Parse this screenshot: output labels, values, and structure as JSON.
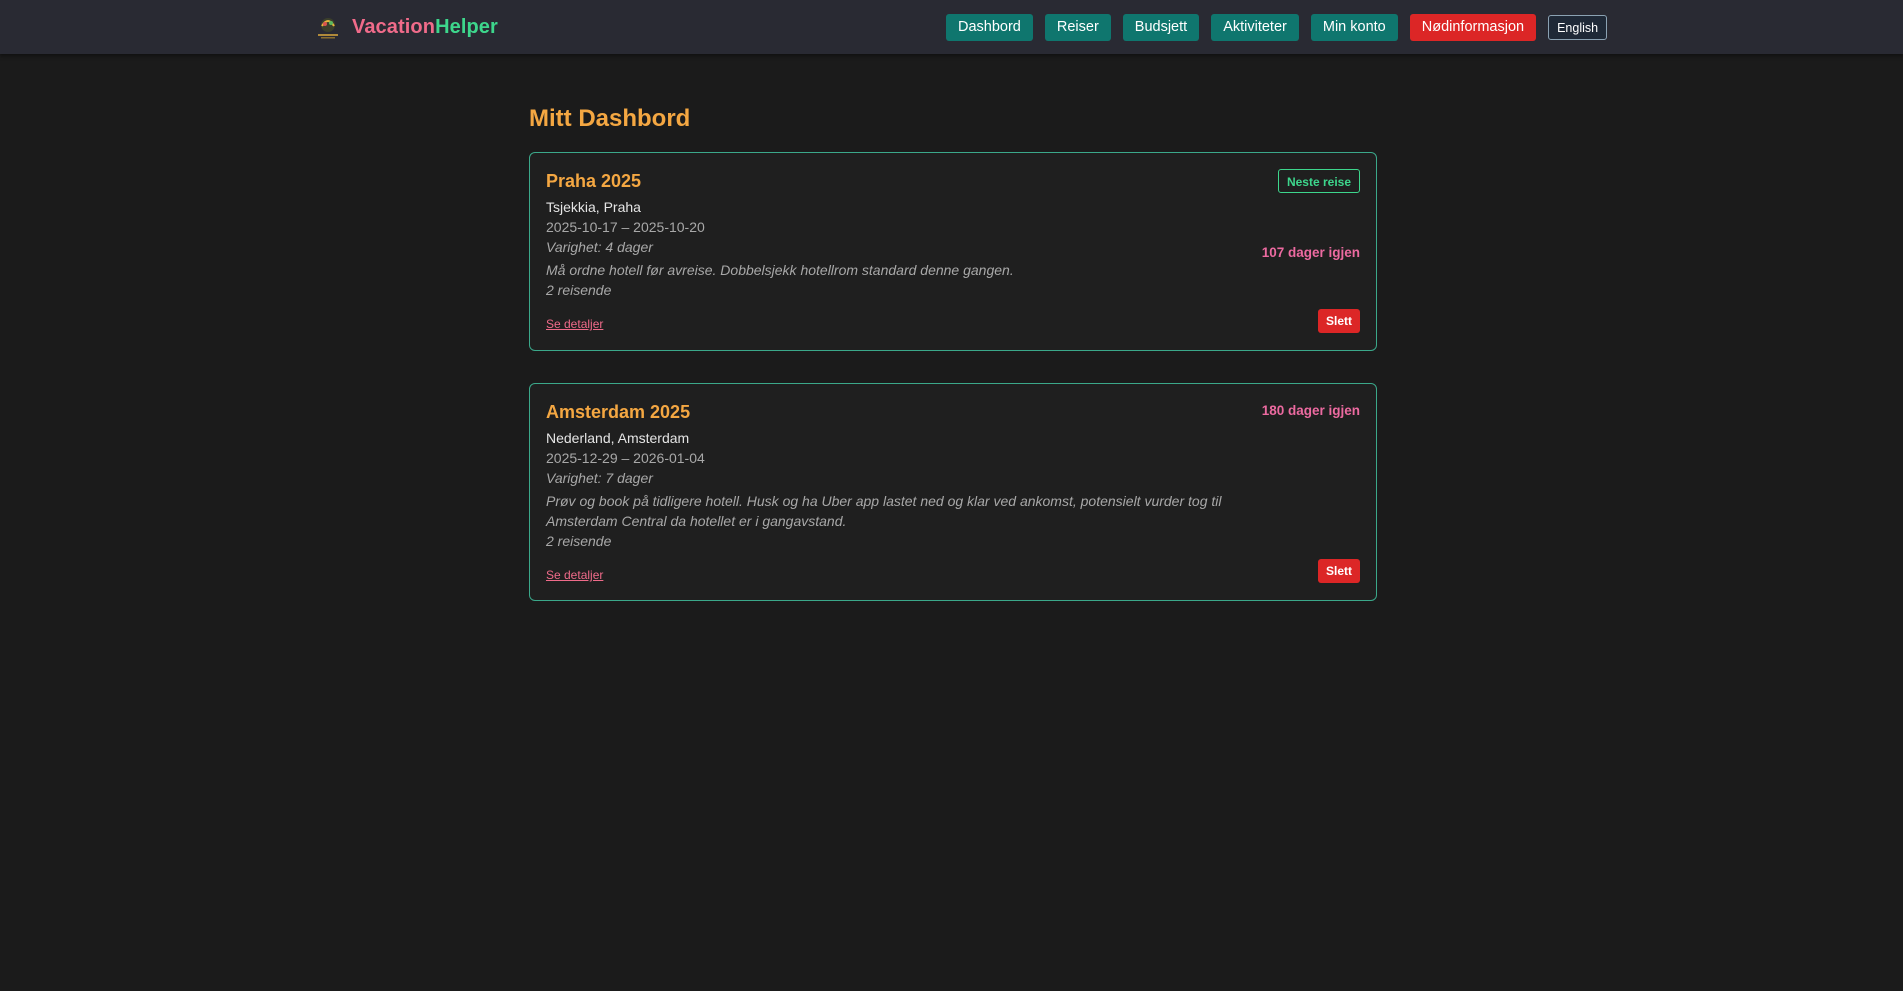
{
  "header": {
    "brand_part1": "Vacation",
    "brand_part2": "Helper",
    "nav": {
      "dashboard": "Dashbord",
      "trips": "Reiser",
      "budget": "Budsjett",
      "activities": "Aktiviteter",
      "account": "Min konto",
      "emergency": "Nødinformasjon",
      "language": "English"
    }
  },
  "page": {
    "title": "Mitt Dashbord"
  },
  "trips": [
    {
      "name": "Praha 2025",
      "location": "Tsjekkia, Praha",
      "dates": "2025-10-17 – 2025-10-20",
      "duration": "Varighet: 4 dager",
      "notes": "Må ordne hotell før avreise. Dobbelsjekk hotellrom standard denne gangen.",
      "travelers": "2 reisende",
      "badge": "Neste reise",
      "countdown": "107 dager igjen",
      "details_label": "Se detaljer",
      "delete_label": "Slett"
    },
    {
      "name": "Amsterdam 2025",
      "location": "Nederland, Amsterdam",
      "dates": "2025-12-29 – 2026-01-04",
      "duration": "Varighet: 7 dager",
      "notes": "Prøv og book på tidligere hotell. Husk og ha Uber app lastet ned og klar ved ankomst, potensielt vurder tog til Amsterdam Central da hotellet er i gangavstand.",
      "travelers": "2 reisende",
      "countdown": "180 dager igjen",
      "details_label": "Se detaljer",
      "delete_label": "Slett"
    }
  ],
  "colors": {
    "background": "#1b1b1b",
    "navbar": "#292a33",
    "primary_button": "#0f766e",
    "danger": "#dc2626",
    "accent_orange": "#f4a742",
    "accent_pink": "#f06b8a",
    "accent_green": "#3dd68c",
    "card_border": "#3ba88a"
  },
  "icons": {
    "logo": "vacation-logo-icon"
  }
}
